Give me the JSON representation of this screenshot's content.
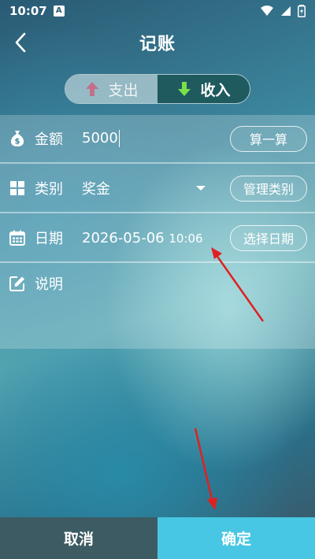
{
  "status_bar": {
    "time": "10:07",
    "notification_badge": "A"
  },
  "header": {
    "title": "记账"
  },
  "segment": {
    "expense_label": "支出",
    "income_label": "收入",
    "selected": "收入"
  },
  "form": {
    "amount": {
      "label": "金额",
      "value": "5000",
      "action_label": "算一算"
    },
    "category": {
      "label": "类别",
      "value": "奖金",
      "action_label": "管理类别"
    },
    "date": {
      "label": "日期",
      "date_value": "2026-05-06",
      "time_value": "10:06",
      "action_label": "选择日期"
    },
    "note": {
      "label": "说明",
      "value": ""
    }
  },
  "footer": {
    "cancel_label": "取消",
    "confirm_label": "确定"
  },
  "colors": {
    "income_tab_bg": "#1f5a5f",
    "confirm_bg": "#47c7e3",
    "cancel_bg": "#3c5b62",
    "expense_icon": "#c2708a",
    "income_icon": "#7be04a",
    "annotation_arrow": "#e02020"
  },
  "icons": {
    "back": "chevron-left-icon",
    "expense": "arrow-up-icon",
    "income": "arrow-down-icon",
    "amount": "money-bag-icon",
    "category": "grid-icon",
    "date": "calendar-icon",
    "note": "edit-icon"
  }
}
